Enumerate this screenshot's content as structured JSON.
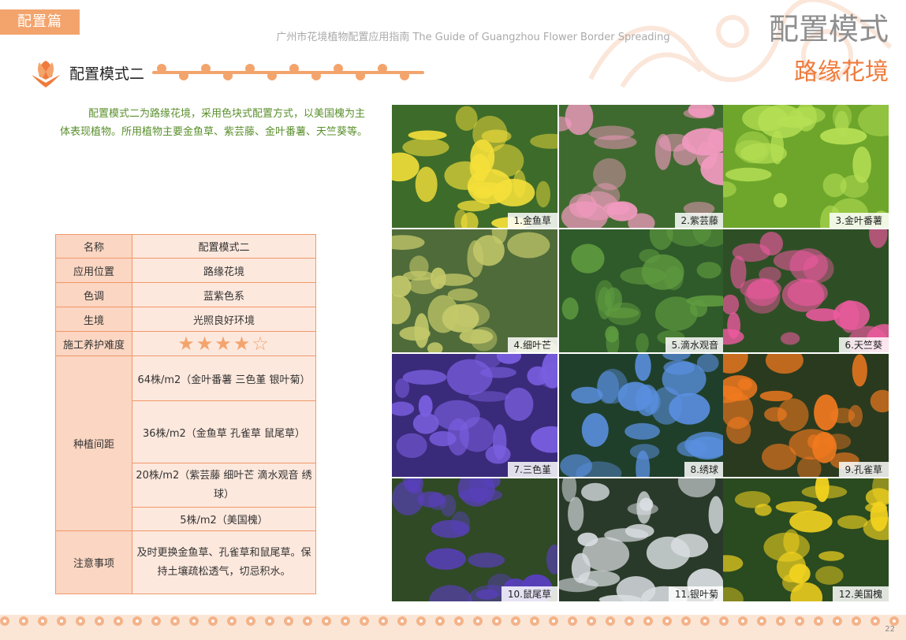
{
  "header": {
    "tag": "配置篇",
    "guide": "广州市花境植物配置应用指南 The Guide of Guangzhou Flower Border Spreading",
    "title": "配置模式",
    "subtitle": "路缘花境"
  },
  "section": {
    "title": "配置模式二"
  },
  "intro": "配置模式二为路缘花境，采用色块式配置方式，以美国槐为主体表现植物。所用植物主要金鱼草、紫芸藤、金叶番薯、天竺葵等。",
  "table": {
    "name_label": "名称",
    "name_value": "配置模式二",
    "pos_label": "应用位置",
    "pos_value": "路缘花境",
    "tone_label": "色调",
    "tone_value": "蓝紫色系",
    "env_label": "生境",
    "env_value": "光照良好环境",
    "diff_label": "施工养护难度",
    "diff_value": "★★★★☆",
    "spacing_label": "种植间距",
    "spacing": [
      "64株/m2（金叶番薯 三色堇 银叶菊）",
      "36株/m2（金鱼草 孔雀草 鼠尾草）",
      "20株/m2（紫芸藤 细叶芒 滴水观音 绣球）",
      "5株/m2（美国槐）"
    ],
    "note_label": "注意事项",
    "note": "及时更换金鱼草、孔雀草和鼠尾草。保持土壤疏松透气，切忌积水。"
  },
  "photos": [
    {
      "caption": "1.金鱼草",
      "bg": "#3d6b2a",
      "fg": "#f5e03a"
    },
    {
      "caption": "2.紫芸藤",
      "bg": "#3f6a2f",
      "fg": "#f29ac0"
    },
    {
      "caption": "3.金叶番薯",
      "bg": "#6ea62b",
      "fg": "#b6e055"
    },
    {
      "caption": "4.细叶芒",
      "bg": "#4f6b3a",
      "fg": "#c4c96a"
    },
    {
      "caption": "5.滴水观音",
      "bg": "#2f5a2a",
      "fg": "#5f9b3f"
    },
    {
      "caption": "6.天竺葵",
      "bg": "#2e4f25",
      "fg": "#ee5aa0"
    },
    {
      "caption": "7.三色堇",
      "bg": "#3a2a7a",
      "fg": "#7a5fe0"
    },
    {
      "caption": "8.绣球",
      "bg": "#1f3f2a",
      "fg": "#5a8fe0"
    },
    {
      "caption": "9.孔雀草",
      "bg": "#2a3a1f",
      "fg": "#f27a1f"
    },
    {
      "caption": "10.鼠尾草",
      "bg": "#2f4a25",
      "fg": "#5a3fc0"
    },
    {
      "caption": "11.银叶菊",
      "bg": "#2a3a2a",
      "fg": "#d8dde0"
    },
    {
      "caption": "12.美国槐",
      "bg": "#2a4a20",
      "fg": "#f2d21f"
    }
  ],
  "page_number": "22",
  "colors": {
    "accent": "#ef7b3c",
    "tag": "#f3a46d",
    "table_border": "#f0986a",
    "intro": "#5a8f2c"
  }
}
